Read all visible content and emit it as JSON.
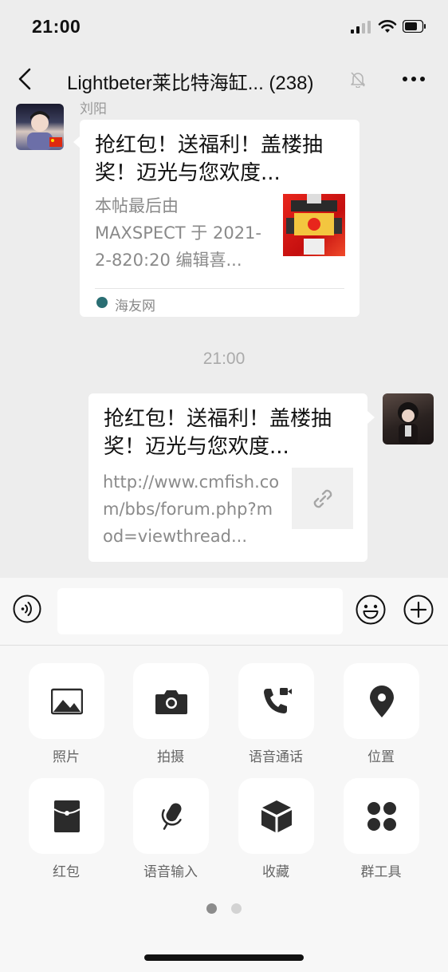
{
  "status_bar": {
    "time": "21:00"
  },
  "nav": {
    "title": "Lightbeter莱比特海缸... (238)"
  },
  "messages": [
    {
      "sender": "刘阳",
      "card_title": "抢红包！送福利！盖楼抽奖！迈光与您欢度...",
      "card_desc": "本帖最后由 MAXSPECT 于 2021-2-820:20 编辑喜...",
      "source": "海友网"
    },
    {
      "card_title": "抢红包！送福利！盖楼抽奖！迈光与您欢度...",
      "card_desc": "http://www.cmfish.com/bbs/forum.php?mod=viewthread..."
    }
  ],
  "timestamp": "21:00",
  "panel": {
    "items": [
      {
        "label": "照片",
        "icon": "photo-icon"
      },
      {
        "label": "拍摄",
        "icon": "camera-icon"
      },
      {
        "label": "语音通话",
        "icon": "call-icon"
      },
      {
        "label": "位置",
        "icon": "location-icon"
      },
      {
        "label": "红包",
        "icon": "red-packet-icon"
      },
      {
        "label": "语音输入",
        "icon": "microphone-icon"
      },
      {
        "label": "收藏",
        "icon": "favorites-icon"
      },
      {
        "label": "群工具",
        "icon": "group-tools-icon"
      }
    ],
    "page_count": 2,
    "current_page": 1
  },
  "colors": {
    "background": "#ededed",
    "bubble": "#ffffff",
    "panel": "#f7f7f7",
    "icon": "#2b2b2b"
  }
}
